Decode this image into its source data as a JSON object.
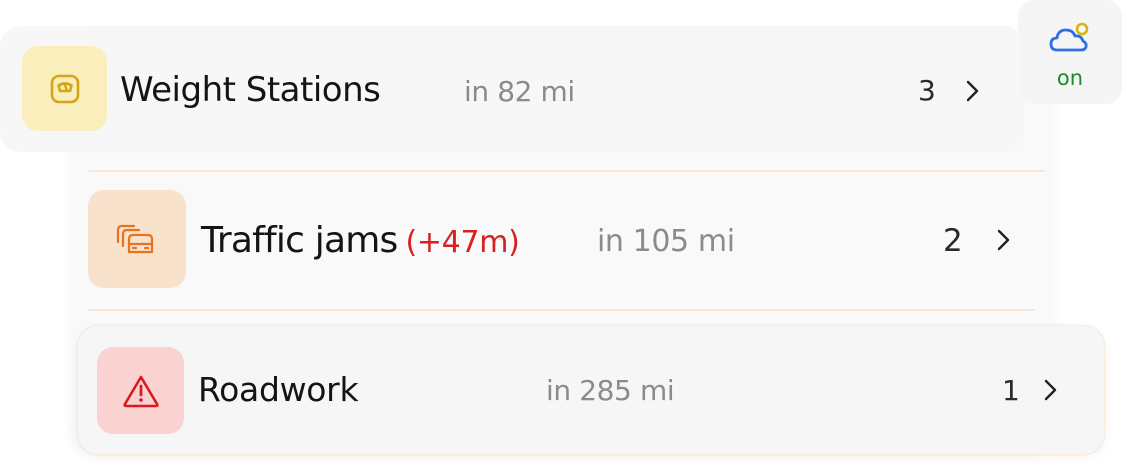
{
  "weather": {
    "icon": "cloud-sun-icon",
    "state_label": "on",
    "state_color": "#1f8a2a"
  },
  "rows": [
    {
      "icon": "scale-icon",
      "title": "Weight Stations",
      "distance": "in 82 mi",
      "count": "3",
      "tile_color": "#faeebd",
      "icon_color": "#d4a514"
    },
    {
      "icon": "traffic-jam-icon",
      "title": "Traffic jams",
      "delay": "(+47m)",
      "distance": "in 105 mi",
      "count": "2",
      "tile_color": "#f9e2cc",
      "icon_color": "#e8731c",
      "delay_color": "#d92020"
    },
    {
      "icon": "warning-icon",
      "title": "Roadwork",
      "distance": "in 285 mi",
      "count": "1",
      "tile_color": "#fbd2d2",
      "icon_color": "#d81c1c"
    }
  ]
}
